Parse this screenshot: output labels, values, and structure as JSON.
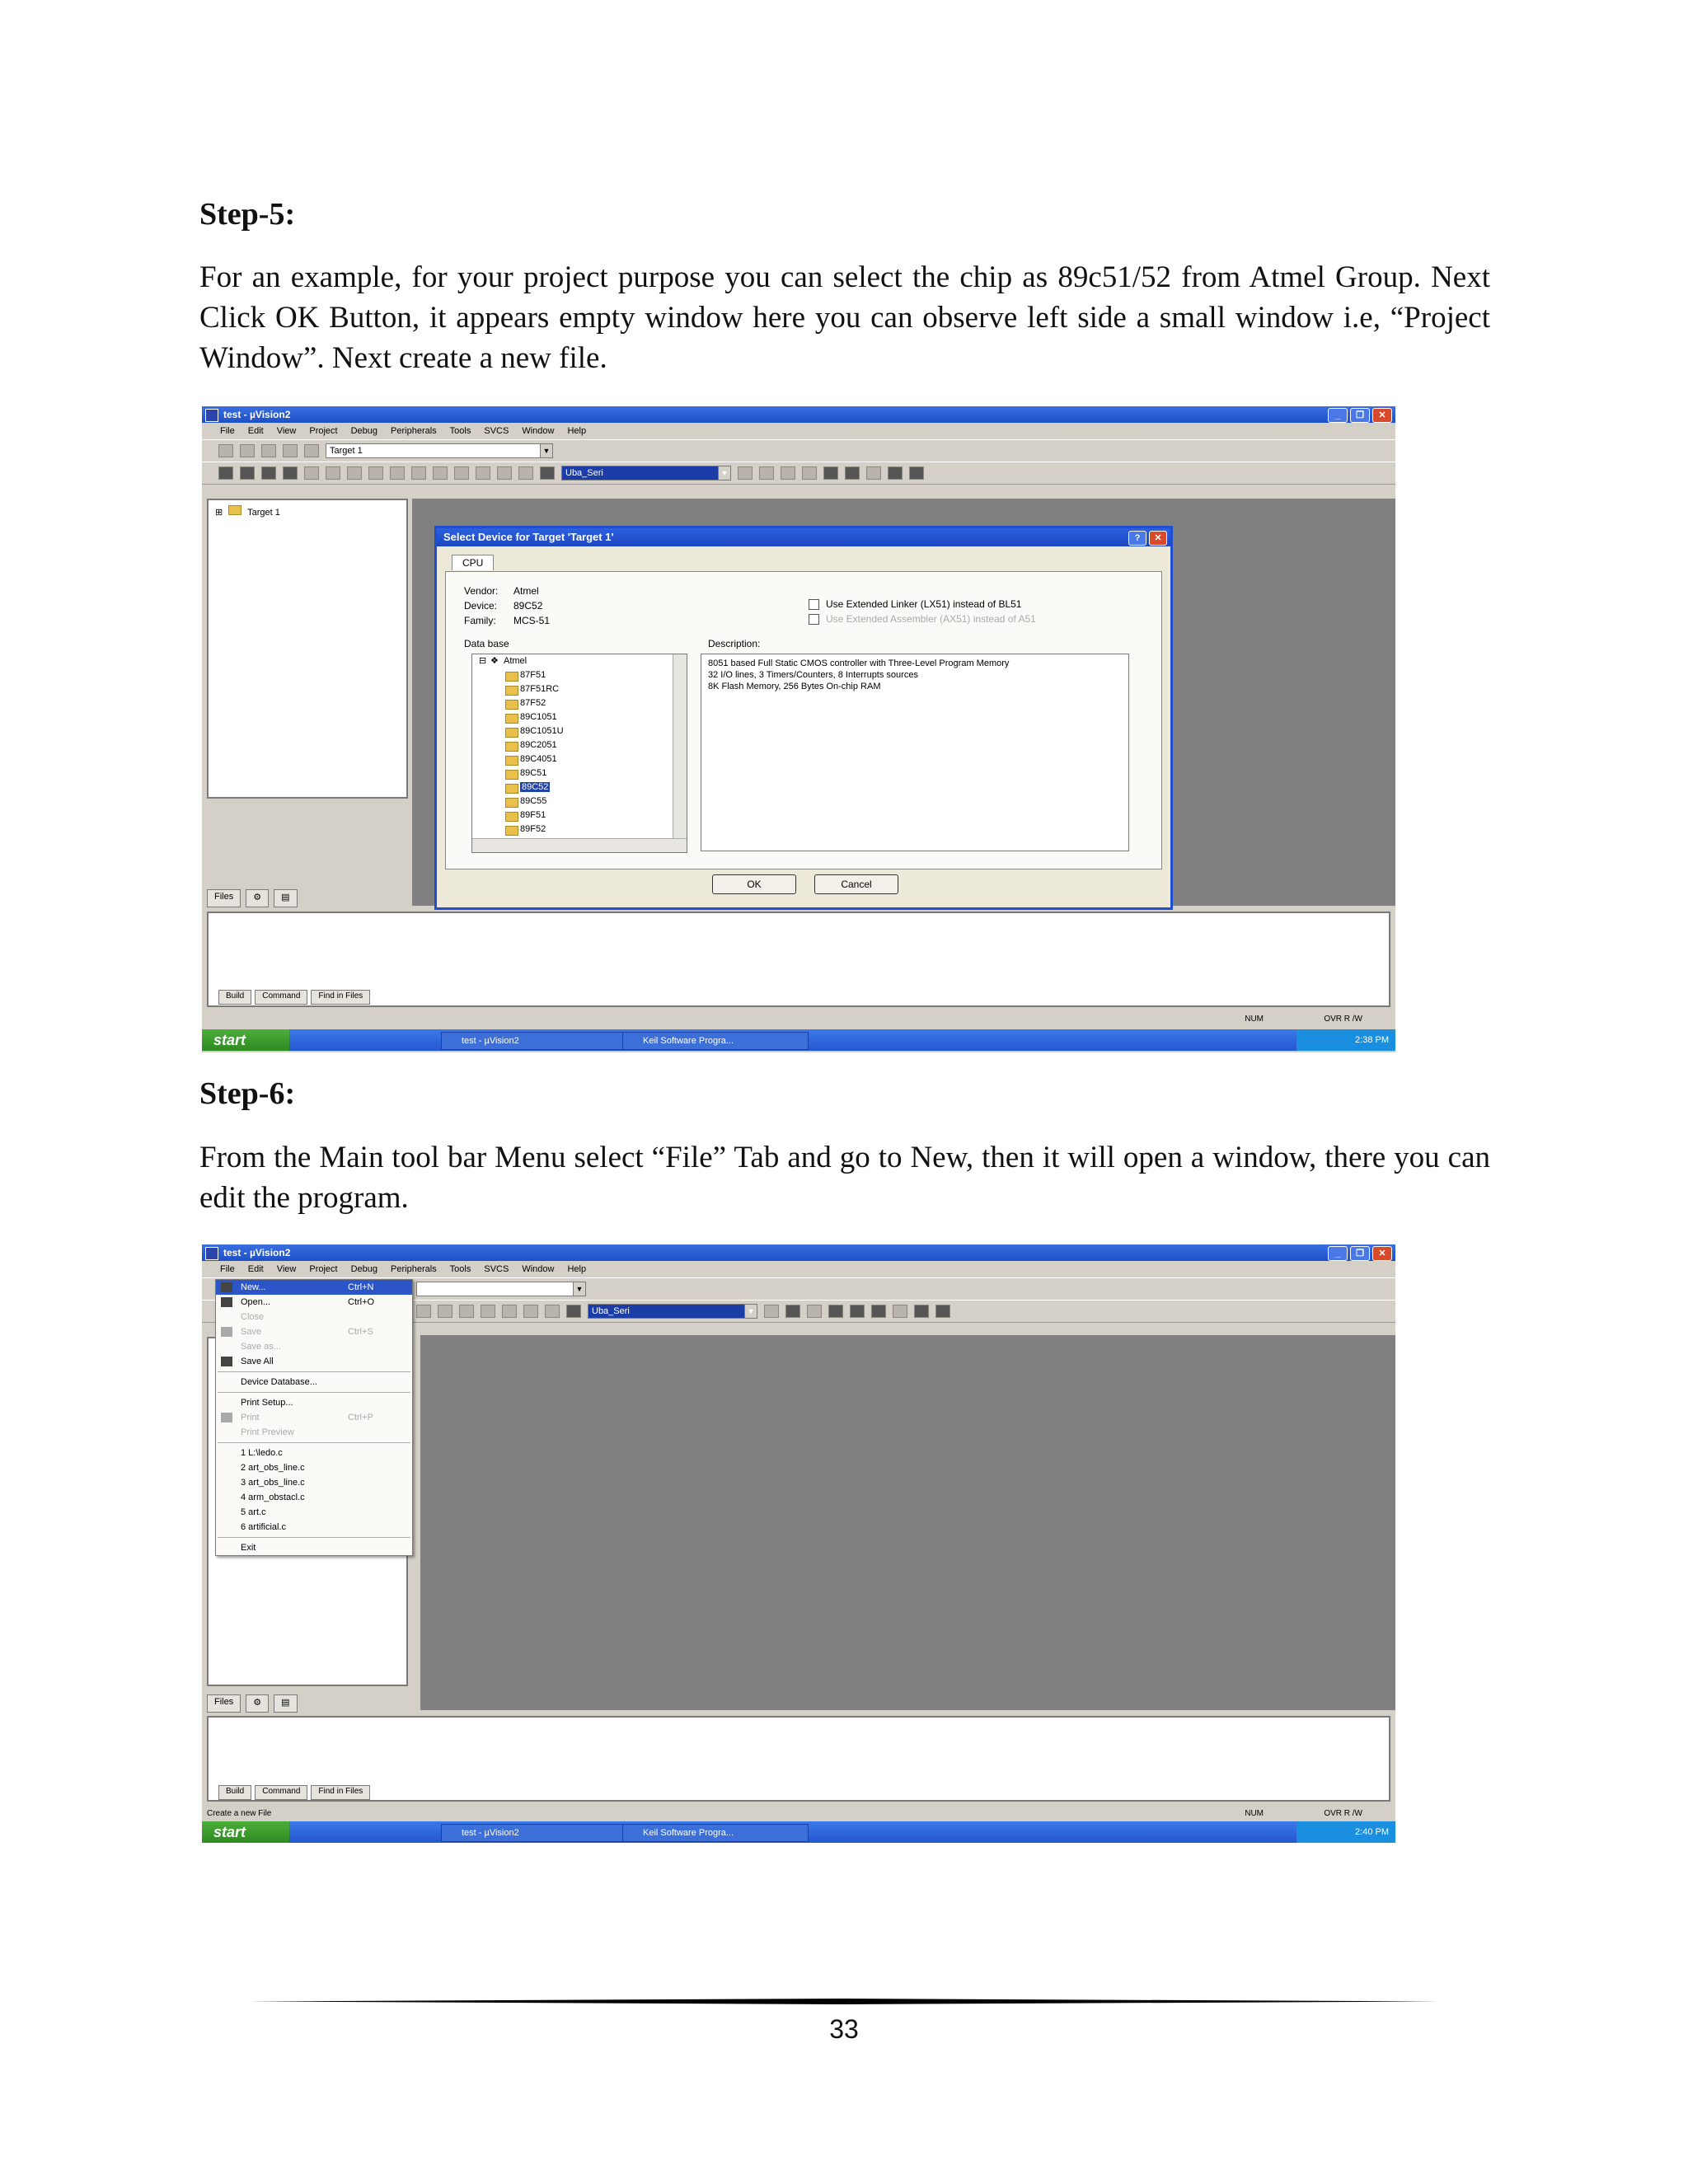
{
  "step5": {
    "heading": "Step-5:",
    "text": "For an example, for your project purpose you can select the chip as 89c51/52 from Atmel Group. Next Click OK Button, it appears empty window here you can observe left side a small window i.e, “Project Window”. Next create a new file."
  },
  "step6": {
    "heading": "Step-6:",
    "text": "From the Main tool bar Menu select “File” Tab and go to New, then it will open a window, there you can edit the program."
  },
  "screenshot1": {
    "window_title": "test - µVision2",
    "menus": [
      "File",
      "Edit",
      "View",
      "Project",
      "Debug",
      "Peripherals",
      "Tools",
      "SVCS",
      "Window",
      "Help"
    ],
    "target_combo": "Target 1",
    "function_combo": "Uba_Seri",
    "project_tree_item": "Target 1",
    "project_tabs": [
      "Files",
      "",
      ""
    ],
    "output_tabs": [
      "Build",
      "Command",
      "Find in Files"
    ],
    "status_right": [
      "NUM",
      "OVR R /W"
    ],
    "taskbar": {
      "start": "start",
      "task1": "test - µVision2",
      "task2": "Keil Software Progra...",
      "clock": "2:38 PM"
    },
    "dialog": {
      "title": "Select Device for Target 'Target 1'",
      "tab": "CPU",
      "vendor_label": "Vendor:",
      "vendor_value": "Atmel",
      "device_label": "Device:",
      "device_value": "89C52",
      "family_label": "Family:",
      "family_value": "MCS-51",
      "database_label": "Data base",
      "description_label": "Description:",
      "check1": "Use Extended Linker (LX51) instead of BL51",
      "check2": "Use Extended Assembler (AX51) instead of A51",
      "tree_root": "Atmel",
      "devices": [
        "87F51",
        "87F51RC",
        "87F52",
        "89C1051",
        "89C1051U",
        "89C2051",
        "89C4051",
        "89C51",
        "89C52",
        "89C55",
        "89F51",
        "89F52"
      ],
      "selected_device": "89C52",
      "description_lines": [
        "8051 based Full Static CMOS controller with Three-Level Program Memory",
        "32 I/O lines, 3 Timers/Counters, 8 Interrupts sources",
        "8K Flash Memory, 256 Bytes On-chip RAM"
      ],
      "ok": "OK",
      "cancel": "Cancel"
    }
  },
  "screenshot2": {
    "window_title": "test - µVision2",
    "menus": [
      "File",
      "Edit",
      "View",
      "Project",
      "Debug",
      "Peripherals",
      "Tools",
      "SVCS",
      "Window",
      "Help"
    ],
    "function_combo": "Uba_Seri",
    "project_tabs": [
      "Files",
      "",
      ""
    ],
    "output_tabs": [
      "Build",
      "Command",
      "Find in Files"
    ],
    "status_left": "Create a new File",
    "status_right": [
      "NUM",
      "OVR R /W"
    ],
    "taskbar": {
      "start": "start",
      "task1": "test - µVision2",
      "task2": "Keil Software Progra...",
      "clock": "2:40 PM"
    },
    "file_menu": [
      {
        "label": "New...",
        "shortcut": "Ctrl+N",
        "state": "selected"
      },
      {
        "label": "Open...",
        "shortcut": "Ctrl+O",
        "state": "normal"
      },
      {
        "label": "Close",
        "shortcut": "",
        "state": "disabled"
      },
      {
        "label": "Save",
        "shortcut": "Ctrl+S",
        "state": "disabled"
      },
      {
        "label": "Save as...",
        "shortcut": "",
        "state": "disabled"
      },
      {
        "label": "Save All",
        "shortcut": "",
        "state": "normal"
      },
      {
        "label": "Device Database...",
        "shortcut": "",
        "state": "normal"
      },
      {
        "label": "Print Setup...",
        "shortcut": "",
        "state": "normal"
      },
      {
        "label": "Print",
        "shortcut": "Ctrl+P",
        "state": "disabled"
      },
      {
        "label": "Print Preview",
        "shortcut": "",
        "state": "disabled"
      },
      {
        "label": "1 L:\\ledo.c",
        "shortcut": "",
        "state": "normal"
      },
      {
        "label": "2 art_obs_line.c",
        "shortcut": "",
        "state": "normal"
      },
      {
        "label": "3 art_obs_line.c",
        "shortcut": "",
        "state": "normal"
      },
      {
        "label": "4 arm_obstacl.c",
        "shortcut": "",
        "state": "normal"
      },
      {
        "label": "5 art.c",
        "shortcut": "",
        "state": "normal"
      },
      {
        "label": "6 artificial.c",
        "shortcut": "",
        "state": "normal"
      },
      {
        "label": "Exit",
        "shortcut": "",
        "state": "normal"
      }
    ]
  },
  "footer": {
    "page_number": "33"
  }
}
